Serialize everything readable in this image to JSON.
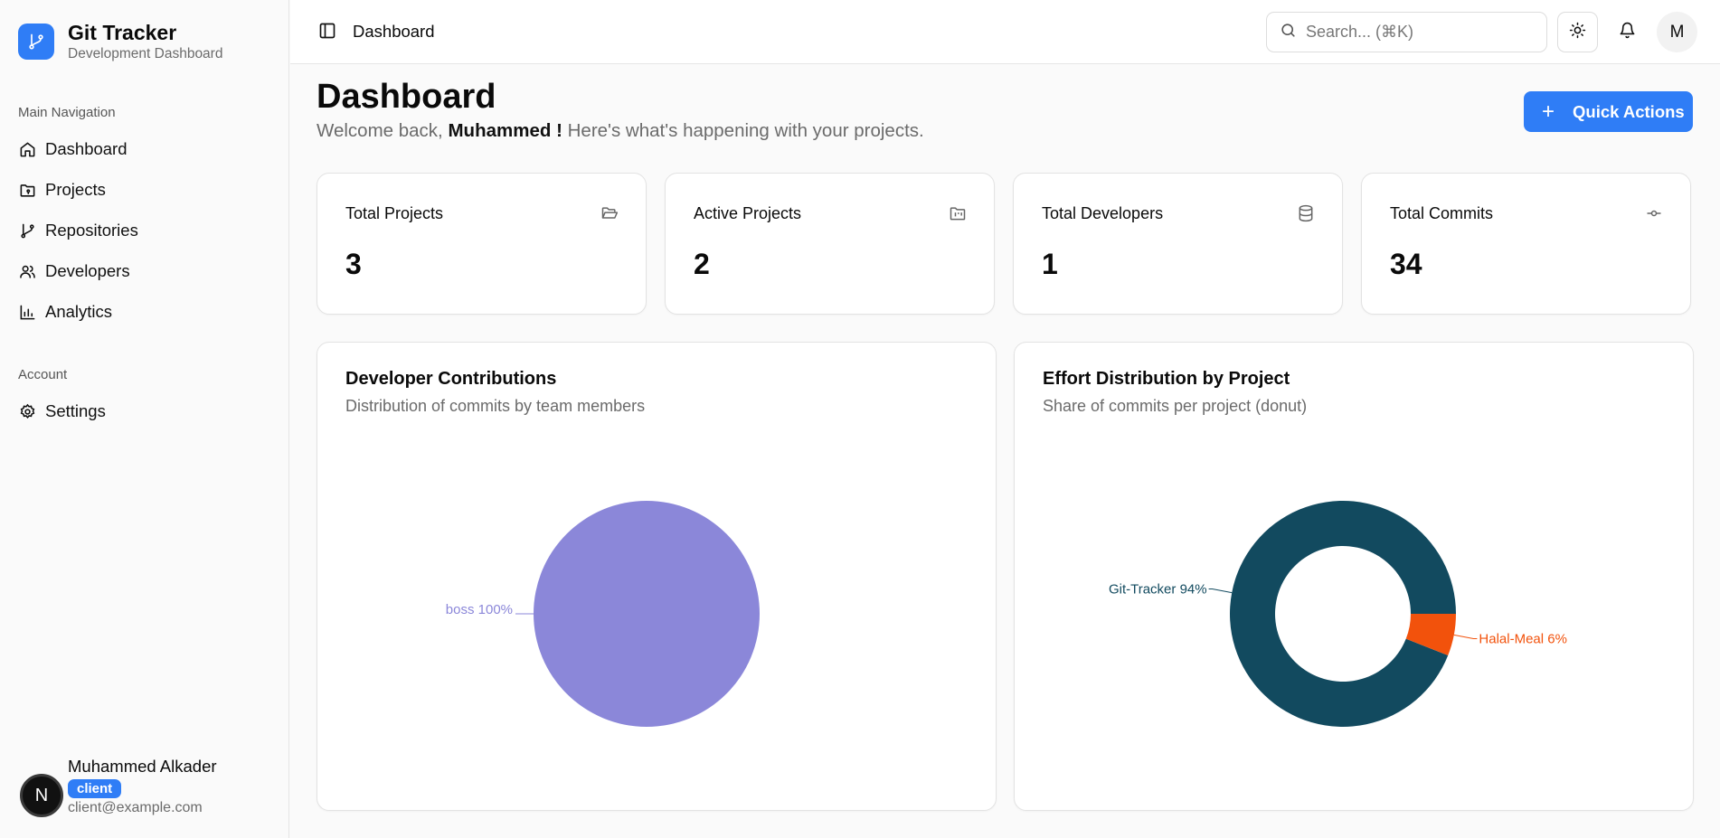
{
  "brand": {
    "title": "Git Tracker",
    "subtitle": "Development Dashboard"
  },
  "sidebar": {
    "main_label": "Main Navigation",
    "items": [
      {
        "label": "Dashboard",
        "icon": "home-icon"
      },
      {
        "label": "Projects",
        "icon": "folder-git-icon"
      },
      {
        "label": "Repositories",
        "icon": "git-branch-icon"
      },
      {
        "label": "Developers",
        "icon": "users-icon"
      },
      {
        "label": "Analytics",
        "icon": "bar-chart-icon"
      }
    ],
    "account_label": "Account",
    "account_items": [
      {
        "label": "Settings",
        "icon": "gear-icon"
      }
    ]
  },
  "user": {
    "avatar_initial": "N",
    "name": "Muhammed Alkader",
    "role": "client",
    "email": "client@example.com"
  },
  "header": {
    "breadcrumb": "Dashboard",
    "search_placeholder": "Search... (⌘K)",
    "avatar_initial": "M"
  },
  "main": {
    "title": "Dashboard",
    "welcome_prefix": "Welcome back,",
    "welcome_name": "Muhammed !",
    "welcome_suffix": "Here's what's happening with your projects.",
    "quick_actions_label": "Quick Actions"
  },
  "stats": [
    {
      "label": "Total Projects",
      "value": "3",
      "icon": "folder-open-icon"
    },
    {
      "label": "Active Projects",
      "value": "2",
      "icon": "folder-kanban-icon"
    },
    {
      "label": "Total Developers",
      "value": "1",
      "icon": "database-icon"
    },
    {
      "label": "Total Commits",
      "value": "34",
      "icon": "git-commit-icon"
    }
  ],
  "colors": {
    "accent": "#2f7df6",
    "pie": "#8b87d9",
    "donut_main": "#124a5f",
    "donut_secondary": "#f2520c"
  },
  "chart_data": [
    {
      "type": "pie",
      "title": "Developer Contributions",
      "subtitle": "Distribution of commits by team members",
      "slices": [
        {
          "label": "boss 100%",
          "name": "boss",
          "value": 100,
          "color": "#8b87d9"
        }
      ]
    },
    {
      "type": "pie",
      "title": "Effort Distribution by Project",
      "subtitle": "Share of commits per project (donut)",
      "donut": true,
      "slices": [
        {
          "label": "Git-Tracker 94%",
          "name": "Git-Tracker",
          "value": 94,
          "color": "#124a5f"
        },
        {
          "label": "Halal-Meal 6%",
          "name": "Halal-Meal",
          "value": 6,
          "color": "#f2520c"
        }
      ]
    }
  ]
}
